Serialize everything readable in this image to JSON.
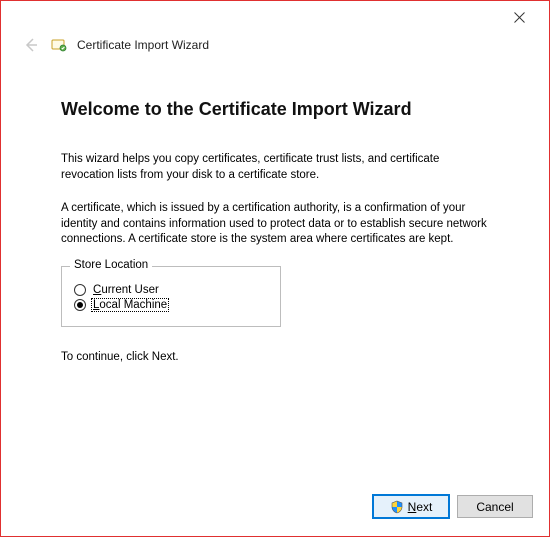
{
  "window": {
    "wizard_name": "Certificate Import Wizard"
  },
  "content": {
    "heading": "Welcome to the Certificate Import Wizard",
    "para1": "This wizard helps you copy certificates, certificate trust lists, and certificate revocation lists from your disk to a certificate store.",
    "para2": "A certificate, which is issued by a certification authority, is a confirmation of your identity and contains information used to protect data or to establish secure network connections. A certificate store is the system area where certificates are kept.",
    "store_location": {
      "legend": "Store Location",
      "options": [
        {
          "label": "Current User",
          "selected": false
        },
        {
          "label": "Local Machine",
          "selected": true
        }
      ]
    },
    "continue_text": "To continue, click Next."
  },
  "footer": {
    "next_label": "Next",
    "cancel_label": "Cancel"
  }
}
